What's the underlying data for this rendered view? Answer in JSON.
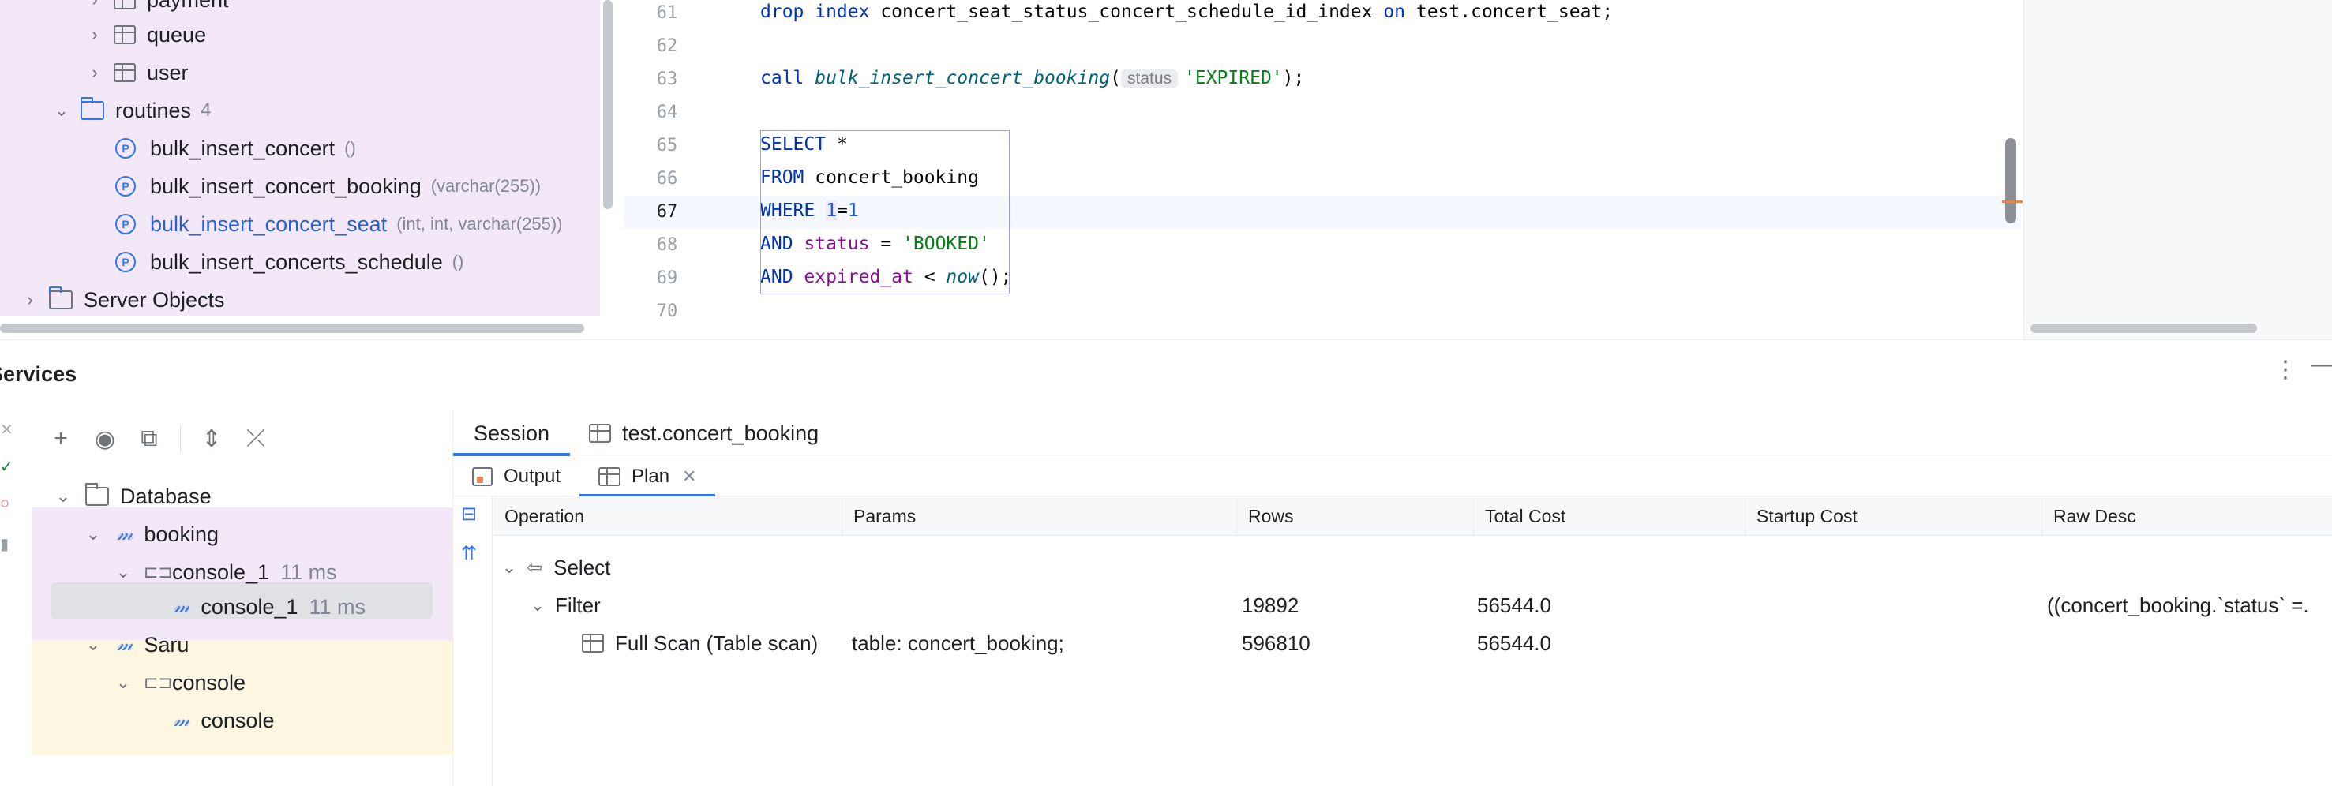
{
  "db_tree": {
    "items": [
      {
        "label": "payment",
        "type": "table"
      },
      {
        "label": "queue",
        "type": "table"
      },
      {
        "label": "user",
        "type": "table"
      },
      {
        "label": "routines",
        "type": "folder",
        "count": "4"
      },
      {
        "label": "bulk_insert_concert",
        "hint": "()"
      },
      {
        "label": "bulk_insert_concert_booking",
        "hint": "(varchar(255))"
      },
      {
        "label": "bulk_insert_concert_seat",
        "hint": "(int, int, varchar(255))"
      },
      {
        "label": "bulk_insert_concerts_schedule",
        "hint": "()"
      },
      {
        "label": "Server Objects",
        "type": "folder"
      }
    ]
  },
  "editor": {
    "line_numbers": [
      "61",
      "62",
      "63",
      "64",
      "65",
      "66",
      "67",
      "68",
      "69",
      "70"
    ],
    "line61": {
      "kw1": "drop index",
      "ident": " concert_seat_status_concert_schedule_id_index ",
      "kw2": "on",
      "rest": " test.concert_seat;"
    },
    "line63": {
      "kw": "call ",
      "fn": "bulk_insert_concert_booking",
      "open": "(",
      "hint": "status",
      "str": "'EXPIRED'",
      "close": ");"
    },
    "line65": {
      "kw": "SELECT",
      "rest": " *"
    },
    "line66": {
      "kw": "FROM",
      "rest": " concert_booking"
    },
    "line67": {
      "kw": "WHERE ",
      "n1": "1",
      "eq": "=",
      "n2": "1"
    },
    "line68": {
      "kw": "AND ",
      "col": "status",
      "op": " = ",
      "str": "'BOOKED'"
    },
    "line69": {
      "kw": "AND ",
      "col": "expired_at",
      "op": " < ",
      "fn": "now",
      "rest": "();"
    }
  },
  "services": {
    "title": "Services",
    "tree": {
      "database": "Database",
      "booking": "booking",
      "console_1_group": "console_1",
      "console_1_group_time": "11 ms",
      "console_1": "console_1",
      "console_1_time": "11 ms",
      "saru": "Saru",
      "console_group": "console",
      "console": "console"
    },
    "tabs": [
      {
        "label": "Session"
      },
      {
        "label": "test.concert_booking"
      }
    ],
    "subtabs": [
      {
        "label": "Output"
      },
      {
        "label": "Plan"
      }
    ],
    "plan": {
      "columns": [
        "Operation",
        "Params",
        "Rows",
        "Total Cost",
        "Startup Cost",
        "Raw Desc"
      ],
      "rows": [
        {
          "operation": "Select",
          "params": "",
          "rows": "",
          "total_cost": "",
          "startup_cost": "",
          "raw_desc": ""
        },
        {
          "operation": "Filter",
          "params": "",
          "rows": "19892",
          "total_cost": "56544.0",
          "startup_cost": "",
          "raw_desc": "((concert_booking.`status` =."
        },
        {
          "operation": "Full Scan (Table scan)",
          "params": "table: concert_booking;",
          "rows": "596810",
          "total_cost": "56544.0",
          "startup_cost": "",
          "raw_desc": ""
        }
      ]
    }
  }
}
